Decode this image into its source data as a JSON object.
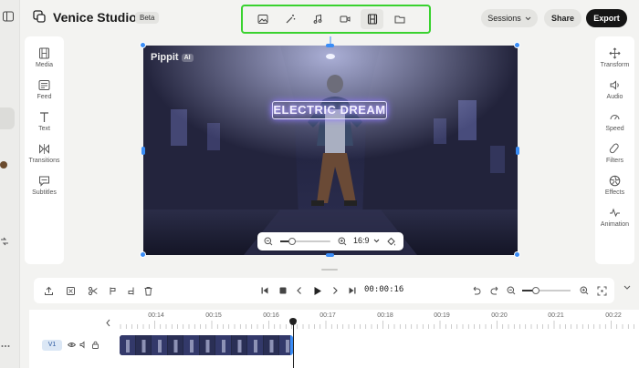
{
  "header": {
    "title": "Venice Studio",
    "badge": "Beta",
    "tools": [
      "image-icon",
      "magic-wand-icon",
      "music-icon",
      "video-camera-icon",
      "film-icon",
      "folder-icon"
    ],
    "sessions_label": "Sessions",
    "share_label": "Share",
    "export_label": "Export"
  },
  "left_panel": {
    "items": [
      {
        "label": "Media",
        "icon": "film-strip-icon"
      },
      {
        "label": "Feed",
        "icon": "feed-icon"
      },
      {
        "label": "Text",
        "icon": "text-icon"
      },
      {
        "label": "Transitions",
        "icon": "transitions-icon"
      },
      {
        "label": "Subtitles",
        "icon": "subtitles-icon"
      }
    ]
  },
  "right_panel": {
    "items": [
      {
        "label": "Transform",
        "icon": "move-icon"
      },
      {
        "label": "Audio",
        "icon": "speaker-icon"
      },
      {
        "label": "Speed",
        "icon": "speedometer-icon"
      },
      {
        "label": "Filters",
        "icon": "filters-icon"
      },
      {
        "label": "Effects",
        "icon": "effects-icon"
      },
      {
        "label": "Animation",
        "icon": "animation-icon"
      }
    ]
  },
  "preview": {
    "watermark": "Pippit",
    "watermark_badge": "AI",
    "neon_text": "ELECTRIC DREAM",
    "aspect_ratio": "16:9"
  },
  "timeline_toolbar": {
    "timecode": "00:00:16"
  },
  "timeline": {
    "ruler": [
      "00:14",
      "00:15",
      "00:16",
      "00:17",
      "00:18",
      "00:19",
      "00:20",
      "00:21",
      "00:22"
    ],
    "playhead_time": "00:16",
    "track_label": "V1"
  },
  "colors": {
    "accent": "#3a8df7",
    "highlight": "#39d22f",
    "export_bg": "#151515"
  }
}
